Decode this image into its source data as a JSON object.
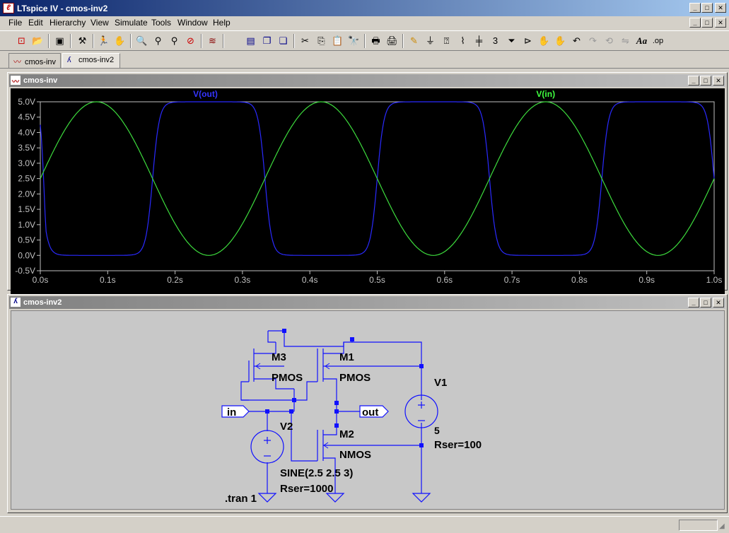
{
  "app": {
    "title": "LTspice IV - cmos-inv2",
    "icon": "ltspice-logo-icon"
  },
  "menu": [
    "File",
    "Edit",
    "Hierarchy",
    "View",
    "Simulate",
    "Tools",
    "Window",
    "Help"
  ],
  "toolbar": {
    "icons": [
      "new-schematic-icon",
      "open-icon",
      "save-icon",
      "control-panel-icon",
      "run-icon",
      "pan-hand-icon",
      "zoom-in-icon",
      "zoom-out-icon",
      "zoom-fit-icon",
      "zoom-cancel-icon",
      "plot-settings-icon",
      "tile-horizontal-icon",
      "cascade-icon",
      "close-all-icon",
      "cut-icon",
      "copy-icon",
      "paste-icon",
      "find-icon",
      "print-preview-icon",
      "print-icon",
      "draw-wire-icon",
      "ground-icon",
      "label-net-icon",
      "resistor-icon",
      "capacitor-icon",
      "inductor-icon",
      "diode-icon",
      "component-icon",
      "move-icon",
      "drag-icon",
      "undo-icon",
      "redo-icon",
      "rotate-icon",
      "mirror-icon",
      "text-icon",
      "spice-directive-icon"
    ],
    "text_icons": {
      "text": "Aa",
      "directive": ".op"
    }
  },
  "tabs": [
    {
      "label": "cmos-inv",
      "icon": "waveform-icon",
      "active": false
    },
    {
      "label": "cmos-inv2",
      "icon": "schematic-icon",
      "active": true
    }
  ],
  "plot_window": {
    "title": "cmos-inv",
    "trace_labels": {
      "vout": "V(out)",
      "vin": "V(in)"
    },
    "colors": {
      "vout": "#2a2aff",
      "vin": "#3ddc3d",
      "axis": "#c0c0c0",
      "background": "#000000",
      "vout_label": "#3535ff",
      "vin_label": "#40ff40"
    }
  },
  "chart_data": {
    "type": "line",
    "title": "",
    "xlabel": "",
    "ylabel": "",
    "xlim": [
      0,
      1.0
    ],
    "ylim": [
      -0.5,
      5.0
    ],
    "x_ticks": [
      "0.0s",
      "0.1s",
      "0.2s",
      "0.3s",
      "0.4s",
      "0.5s",
      "0.6s",
      "0.7s",
      "0.8s",
      "0.9s",
      "1.0s"
    ],
    "y_ticks": [
      "5.0V",
      "4.5V",
      "4.0V",
      "3.5V",
      "3.0V",
      "2.5V",
      "2.0V",
      "1.5V",
      "1.0V",
      "0.5V",
      "0.0V",
      "-0.5V"
    ],
    "series": [
      {
        "name": "V(in)",
        "kind": "sine",
        "offset": 2.5,
        "amplitude": 2.5,
        "frequency_hz": 3
      },
      {
        "name": "V(out)",
        "kind": "inverter-output",
        "high": 5.0,
        "low": 0.0,
        "start": 4.25
      }
    ],
    "grid": false
  },
  "schematic_window": {
    "title": "cmos-inv2",
    "labels": {
      "m3": "M3",
      "m3_model": "PMOS",
      "m1": "M1",
      "m1_model": "PMOS",
      "m2": "M2",
      "m2_model": "NMOS",
      "v1": "V1",
      "v1_value": "5",
      "v1_rser": "Rser=100",
      "v2": "V2",
      "v2_value": "SINE(2.5 2.5 3)",
      "v2_rser": "Rser=1000",
      "in": "in",
      "out": "out",
      "tran": ".tran 1"
    },
    "colors": {
      "wire": "#1010ff",
      "node": "#1010ff",
      "background": "#c8c8c8",
      "text": "#000000"
    }
  }
}
